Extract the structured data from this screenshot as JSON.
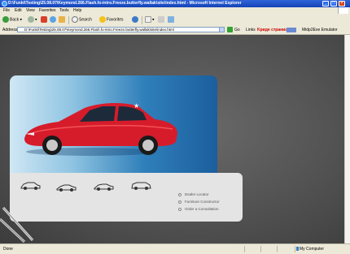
{
  "window": {
    "title": "D:\\Funkt\\Testing\\25.08.07\\Keymond.266.Flash.fo-intro.Freeze.butterfly.wallak\\site\\index.html - Microsoft Internet Explorer"
  },
  "menu": [
    "File",
    "Edit",
    "View",
    "Favorites",
    "Tools",
    "Help"
  ],
  "toolbar": {
    "back": "Back",
    "search": "Search",
    "favorites": "Favorites"
  },
  "address": {
    "label": "Address",
    "value": "D:\\Funkt\\Testing\\25.08.07\\Keymond.266.Flash.fo-intro.Freeze.butterfly.wallak\\site\\index.html",
    "go": "Go",
    "links": "Links",
    "toolbar_brand": "Kриде страницы",
    "extra": "Midp2Exe Emulator"
  },
  "page": {
    "links": [
      "Dealer Locator",
      "Furniture Constructor",
      "Order a Consultation"
    ]
  },
  "status": {
    "text": "Done",
    "zone": "My Computer"
  },
  "colors": {
    "accent_red": "#d61c2b",
    "hero_blue": "#2f7fba"
  }
}
